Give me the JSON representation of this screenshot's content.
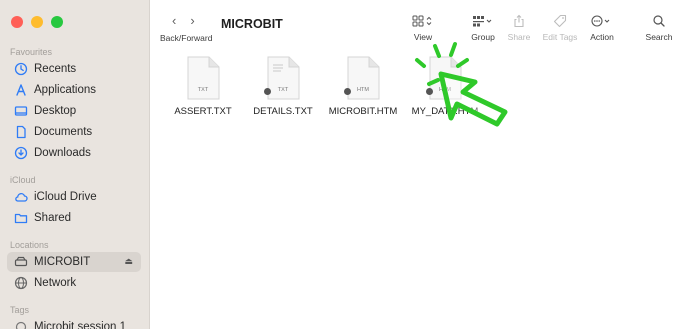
{
  "window": {
    "title": "MICROBIT"
  },
  "sidebar": {
    "sections": [
      {
        "label": "Favourites",
        "items": [
          {
            "label": "Recents",
            "icon": "clock-icon"
          },
          {
            "label": "Applications",
            "icon": "applications-icon"
          },
          {
            "label": "Desktop",
            "icon": "desktop-icon"
          },
          {
            "label": "Documents",
            "icon": "document-icon"
          },
          {
            "label": "Downloads",
            "icon": "download-icon"
          }
        ]
      },
      {
        "label": "iCloud",
        "items": [
          {
            "label": "iCloud Drive",
            "icon": "cloud-icon"
          },
          {
            "label": "Shared",
            "icon": "shared-folder-icon"
          }
        ]
      },
      {
        "label": "Locations",
        "items": [
          {
            "label": "MICROBIT",
            "icon": "drive-icon",
            "selected": true,
            "eject": "⏏"
          },
          {
            "label": "Network",
            "icon": "globe-icon"
          }
        ]
      },
      {
        "label": "Tags",
        "items": [
          {
            "label": "Microbit session 1",
            "icon": "tag-icon"
          }
        ]
      }
    ]
  },
  "toolbar": {
    "back": "‹",
    "forward": "›",
    "nav_label": "Back/Forward",
    "view_label": "View",
    "group_label": "Group",
    "share_label": "Share",
    "edit_tags_label": "Edit Tags",
    "action_label": "Action",
    "search_label": "Search"
  },
  "files": [
    {
      "name": "ASSERT.TXT",
      "ext": "TXT",
      "badge": false
    },
    {
      "name": "DETAILS.TXT",
      "ext": "TXT",
      "badge": true
    },
    {
      "name": "MICROBIT.HTM",
      "ext": "HTM",
      "badge": true
    },
    {
      "name": "MY_DATA.HTM",
      "ext": "HTM",
      "badge": true
    }
  ],
  "colors": {
    "sidebar_bg": "#e9e4df",
    "accent": "#2f7cf6",
    "pointer_green": "#2fc92a"
  }
}
